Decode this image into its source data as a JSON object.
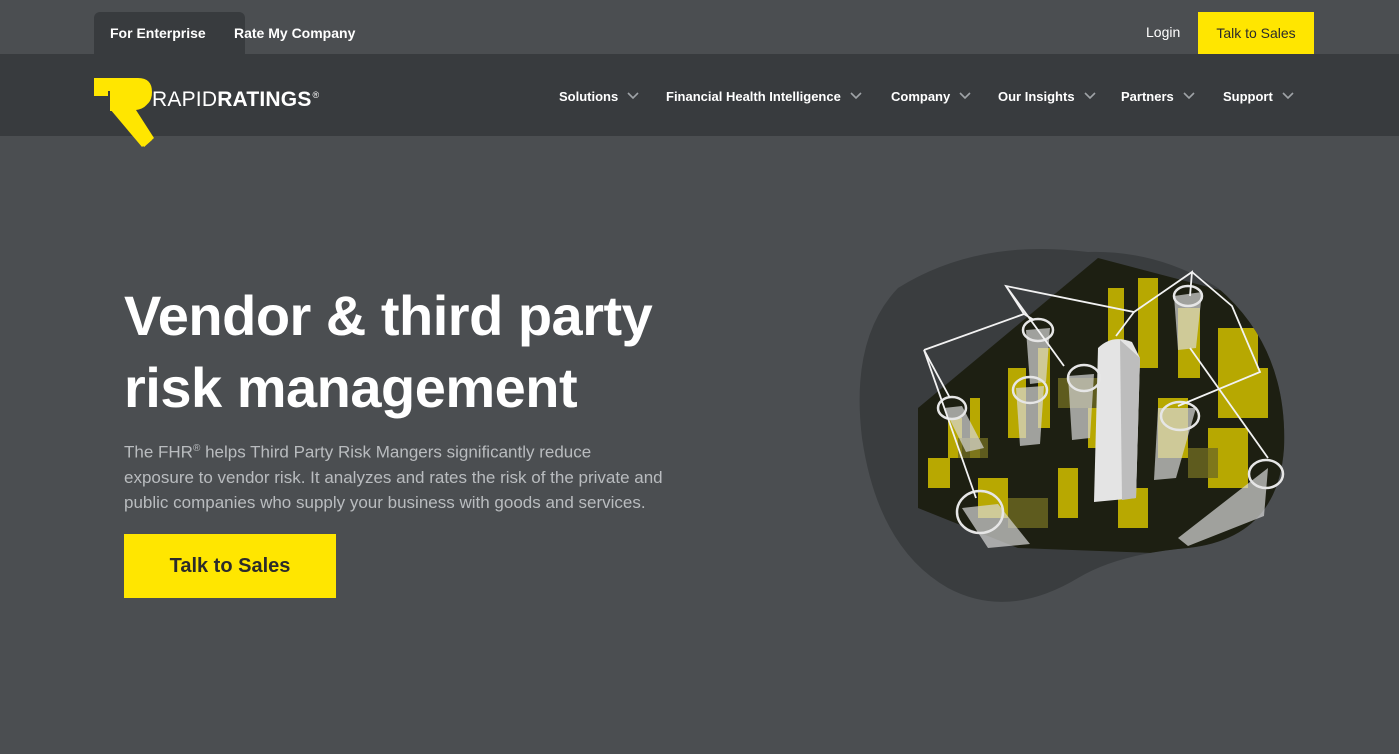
{
  "topbar": {
    "tabs": [
      {
        "label": "For Enterprise",
        "active": true
      },
      {
        "label": "Rate My Company",
        "active": false
      }
    ],
    "login_label": "Login",
    "cta_label": "Talk to Sales"
  },
  "logo": {
    "wordmark_part1": "RAPID",
    "wordmark_part2": "RATINGS",
    "registered": "®"
  },
  "nav": {
    "items": [
      {
        "label": "Solutions"
      },
      {
        "label": "Financial Health Intelligence"
      },
      {
        "label": "Company"
      },
      {
        "label": "Our Insights"
      },
      {
        "label": "Partners"
      },
      {
        "label": "Support"
      }
    ]
  },
  "hero": {
    "title": "Vendor & third party risk management",
    "body_pre": "The FHR",
    "body_sup": "®",
    "body_post": " helps Third Party Risk Mangers significantly reduce exposure to vendor risk. It analyzes and rates the risk of the private and public companies who supply your business with goods and services.",
    "cta_label": "Talk to Sales"
  },
  "colors": {
    "accent": "#ffe600",
    "background": "#4b4e51",
    "navbar": "#383b3e",
    "body_text": "#b9bcbf"
  },
  "icons": {
    "nav_chevron": "chevron-down-icon",
    "hero_image": "city-skyline-illustration"
  }
}
